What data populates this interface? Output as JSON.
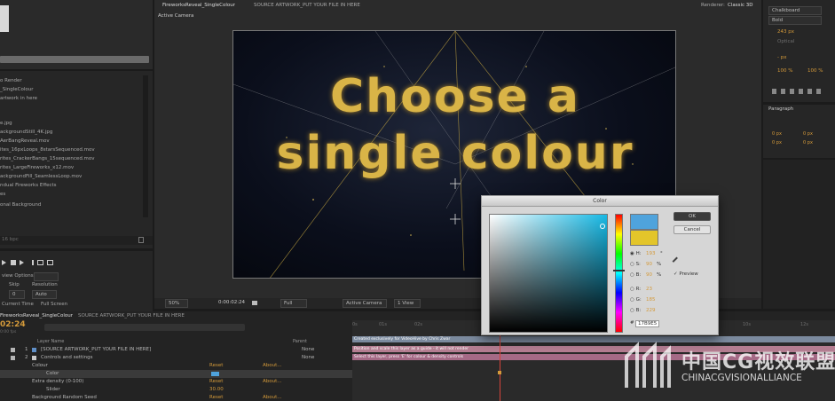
{
  "viewer": {
    "tabs": [
      "FireworksReveal_SingleColour",
      "SOURCE ARTWORK_PUT YOUR FILE IN HERE"
    ],
    "camera_label": "Active Camera",
    "renderer_label": "Renderer:",
    "renderer_value": "Classic 3D",
    "title_line1": "Choose a",
    "title_line2": "single colour",
    "footer": {
      "zoom": "50%",
      "timecode": "0:00:02:24",
      "resolution": "Full",
      "camera": "Active Camera",
      "view": "1 View"
    }
  },
  "project": {
    "items": [
      "o Render",
      "_SingleColour",
      "artwork in here",
      "e.jpg",
      "ackgroundStill_4K.jpg",
      "AerBangReveal.mov",
      "ites_16pxLoops_8starsSequenced.mov",
      "rites_CrackerBangs_15sequenced.mov",
      "rites_LargeFireworks_x12.mov",
      "ackgroundFill_SeamlessLoop.mov",
      "ndual Fireworks Effects",
      "es",
      "onal Background"
    ],
    "bpc": "16 bpc"
  },
  "preview": {
    "options_label": "view Options",
    "skip_label": "Skip",
    "resolution_label": "Resolution",
    "skip_value": "0",
    "resolution_value": "Auto",
    "current_time_label": "Current Time",
    "full_screen_label": "Full Screen"
  },
  "character": {
    "font": "Chalkboard",
    "style": "Bold",
    "size": "243 px",
    "tracking": "100 %",
    "scale": "100 %",
    "baseline": "- px",
    "optical": "Optical"
  },
  "paragraph": {
    "title": "Paragraph",
    "values": [
      "0 px",
      "0 px",
      "0 px",
      "0 px",
      "0 px"
    ]
  },
  "timeline": {
    "comp_tab": "FireworksReveal_SingleColour",
    "source_tab": "SOURCE ARTWORK_PUT YOUR FILE IN HERE",
    "time": "02:24",
    "fps": "0:00 fps",
    "columns": {
      "layer_name": "Layer Name",
      "parent": "Parent"
    },
    "layers": [
      {
        "num": "1",
        "name": "[SOURCE ARTWORK_PUT YOUR FILE IN HERE]",
        "parent": "None"
      },
      {
        "num": "2",
        "name": "Controls and settings",
        "parent": "None"
      }
    ],
    "properties": [
      {
        "name": "Colour",
        "reset": "Reset",
        "about": "About..."
      },
      {
        "name": "Color",
        "value_color": "#4fa3dc"
      },
      {
        "name": "Extra density (0-100)",
        "reset": "Reset",
        "about": "About..."
      },
      {
        "name": "Slider",
        "value": "30.00"
      },
      {
        "name": "Background Random Seed",
        "reset": "Reset",
        "about": "About..."
      }
    ],
    "ruler": [
      "0s",
      "01s",
      "02s",
      "10s",
      "12s"
    ],
    "bar_labels": [
      "Created exclusively for VideoHive by Chris Zwar",
      "Position and scale this layer as a guide - it will not render",
      "Select this layer, press 'E' for colour & density controls"
    ]
  },
  "color_dialog": {
    "title": "Color",
    "ok": "OK",
    "cancel": "Cancel",
    "preview": "Preview",
    "fields": [
      {
        "label": "H:",
        "value": "193",
        "unit": "°"
      },
      {
        "label": "S:",
        "value": "90",
        "unit": "%"
      },
      {
        "label": "B:",
        "value": "90",
        "unit": "%"
      },
      {
        "label": "R:",
        "value": "23",
        "unit": ""
      },
      {
        "label": "G:",
        "value": "185",
        "unit": ""
      },
      {
        "label": "B:",
        "value": "229",
        "unit": ""
      }
    ],
    "hex": "17B9E5",
    "new_color": "#4fa3dc",
    "old_color": "#e3c52a"
  },
  "watermark": {
    "cn": "中国CG视效联盟",
    "en": "CHINACGVISIONALLIANCE"
  }
}
